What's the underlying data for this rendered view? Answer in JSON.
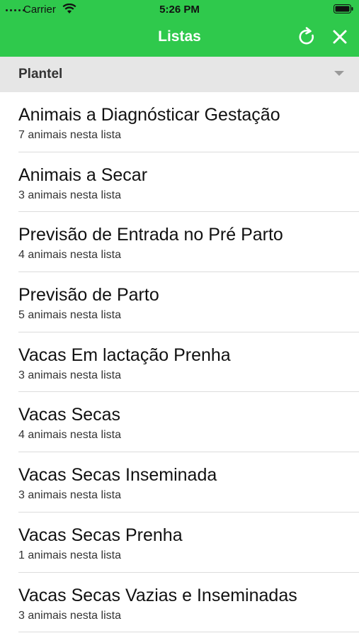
{
  "status_bar": {
    "carrier": "Carrier",
    "time": "5:26 PM"
  },
  "nav": {
    "title": "Listas",
    "refresh_icon": "refresh-icon",
    "close_icon": "close-icon",
    "background_color": "#2fc94c"
  },
  "filter": {
    "selected": "Plantel"
  },
  "lists": [
    {
      "title": "Animais a Diagnósticar Gestação",
      "subtitle": "7 animais nesta lista"
    },
    {
      "title": "Animais a Secar",
      "subtitle": "3 animais nesta lista"
    },
    {
      "title": "Previsão de Entrada no Pré Parto",
      "subtitle": "4 animais nesta lista"
    },
    {
      "title": "Previsão de Parto",
      "subtitle": "5 animais nesta lista"
    },
    {
      "title": "Vacas Em lactação Prenha",
      "subtitle": "3 animais nesta lista"
    },
    {
      "title": "Vacas Secas",
      "subtitle": "4 animais nesta lista"
    },
    {
      "title": "Vacas Secas Inseminada",
      "subtitle": "3 animais nesta lista"
    },
    {
      "title": "Vacas Secas Prenha",
      "subtitle": "1 animais nesta lista"
    },
    {
      "title": "Vacas Secas Vazias e Inseminadas",
      "subtitle": "3 animais nesta lista"
    }
  ]
}
